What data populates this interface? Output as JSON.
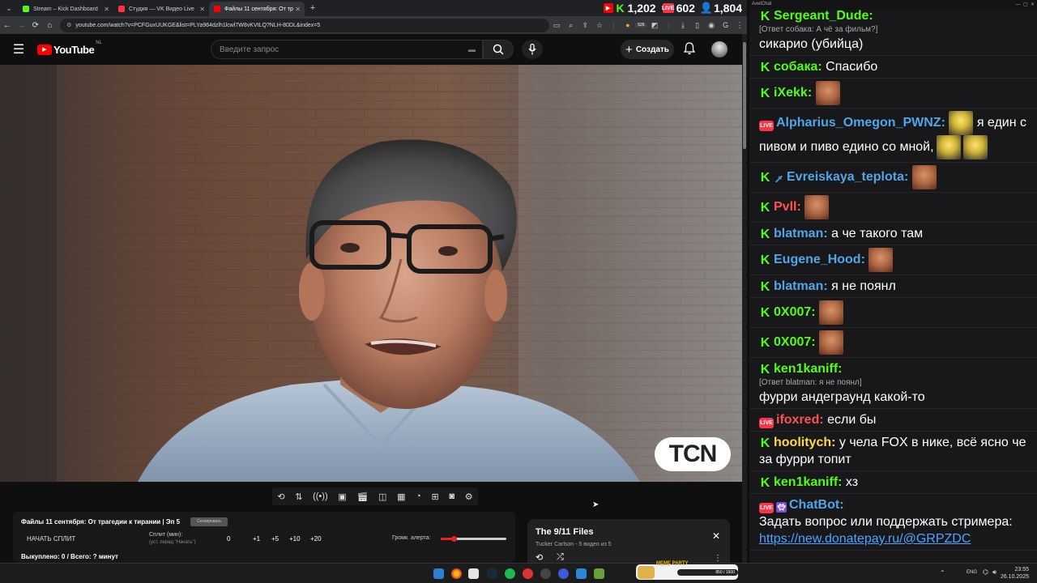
{
  "browser": {
    "tabs": [
      {
        "label": "Stream – Kick Dashboard",
        "color": "#53fc18"
      },
      {
        "label": "Студия — VK Видео Live",
        "color": "#ff3347"
      },
      {
        "label": "Файлы 11 сентября: От тр",
        "color": "#ff0000"
      }
    ],
    "url": "youtube.com/watch?v=PCFGuxUUKGE&list=PLYa964dzlh1lcwl7W8vKVtLQ?NLH-80DL&index=5",
    "stats": {
      "kick": "1,202",
      "vk": "602",
      "viewers": "1,804"
    },
    "ext_count": "526"
  },
  "youtube": {
    "logo": "YouTube",
    "region": "NL",
    "search_placeholder": "Введите запрос",
    "create_label": "Создать"
  },
  "video": {
    "watermark": "TCN"
  },
  "overlay": {
    "title": "Файлы 11 сентября: От трагедии к тирании | Эп 5",
    "title_btn": "Скопировать",
    "start_split": "НАЧАТЬ СПЛИТ",
    "split_label": "Сплит (мин):",
    "split_hint": "(уст. перед \"Начать\")",
    "split_value": "0",
    "steps": [
      "+1",
      "+5",
      "+10",
      "+20"
    ],
    "alert_volume": "Громк. алерта:",
    "bought": "Выкуплено: 0 / Всего: ? минут"
  },
  "playlist": {
    "title": "The 9/11 Files",
    "subtitle": "Tucker Carlson - 5 видео из 5"
  },
  "chat": {
    "window_title": "AxelChat",
    "messages": [
      {
        "badges": [
          "kick"
        ],
        "nick": "Sergeant_Dude:",
        "nick_color": "#53fc18",
        "reply": "[Ответ собака: А чё за фильм?]",
        "text": "сикарио (убийца)",
        "emotes": 0
      },
      {
        "badges": [
          "kick"
        ],
        "nick": "собака:",
        "nick_color": "#53fc18",
        "text": "Спасибо",
        "emotes": 0
      },
      {
        "badges": [
          "kick"
        ],
        "nick": "iXekk:",
        "nick_color": "#53fc18",
        "text": "",
        "emotes": 1
      },
      {
        "badges": [
          "vk"
        ],
        "nick": "Alpharius_Omegon_PWNZ:",
        "nick_color": "#4fa6e8",
        "text": "я един с пивом и пиво едино со мной,",
        "emotes": 3,
        "emote_type": "beer"
      },
      {
        "badges": [
          "kick",
          "sword"
        ],
        "nick": "Evreiskaya_teplota:",
        "nick_color": "#4fa6e8",
        "text": "",
        "emotes": 1
      },
      {
        "badges": [
          "kick"
        ],
        "nick": "Pvll:",
        "nick_color": "#ff5050",
        "text": "",
        "emotes": 1
      },
      {
        "badges": [
          "kick"
        ],
        "nick": "blatman:",
        "nick_color": "#4fa6e8",
        "text": "а че такого там",
        "emotes": 0
      },
      {
        "badges": [
          "kick"
        ],
        "nick": "Eugene_Hood:",
        "nick_color": "#4fa6e8",
        "text": "",
        "emotes": 1
      },
      {
        "badges": [
          "kick"
        ],
        "nick": "blatman:",
        "nick_color": "#4fa6e8",
        "text": "я не поянл",
        "emotes": 0
      },
      {
        "badges": [
          "kick"
        ],
        "nick": "0X007:",
        "nick_color": "#53fc18",
        "text": "",
        "emotes": 1
      },
      {
        "badges": [
          "kick"
        ],
        "nick": "0X007:",
        "nick_color": "#53fc18",
        "text": "",
        "emotes": 1
      },
      {
        "badges": [
          "kick"
        ],
        "nick": "ken1kaniff:",
        "nick_color": "#53fc18",
        "reply": "[Ответ blatman: я не поянл]",
        "text": "фурри андеграунд какой-то",
        "emotes": 0
      },
      {
        "badges": [
          "vk"
        ],
        "nick": "ifoxred:",
        "nick_color": "#ff5050",
        "text": "если бы",
        "emotes": 0
      },
      {
        "badges": [
          "kick"
        ],
        "nick": "hoolitych:",
        "nick_color": "#ffd84d",
        "text": "у чела FOX в нике, всё ясно че за фурри топит",
        "emotes": 0
      },
      {
        "badges": [
          "kick"
        ],
        "nick": "ken1kaniff:",
        "nick_color": "#53fc18",
        "text": "хз",
        "emotes": 0
      },
      {
        "badges": [
          "vk",
          "bot"
        ],
        "nick": "ChatBot:",
        "nick_color": "#4fa6e8",
        "text": "Задать вопрос или поддержать стримера:",
        "link": "https://new.donatepay.ru/@GRPZDC",
        "emotes": 0
      }
    ]
  },
  "taskbar": {
    "lang": "ENG",
    "time": "23:55",
    "date": "26.10.2025",
    "meme_party": "MEME PARTY",
    "meme_progress": "850 / 1500"
  }
}
